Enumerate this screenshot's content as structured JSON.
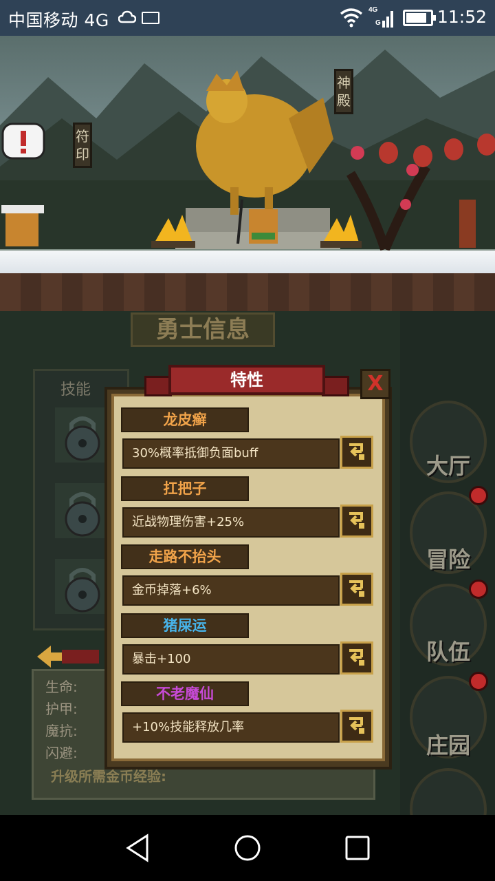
{
  "status_bar": {
    "carrier": "中国移动 4G",
    "time": "11:52",
    "network_type": "4G",
    "battery_level": 0.85
  },
  "scene": {
    "sign_left": "符印",
    "sign_right": "神殿"
  },
  "hero_panel": {
    "title": "勇士信息",
    "skills_label": "技能",
    "stats": {
      "hp_label": "生命:",
      "armor_label": "护甲:",
      "magic_resist_label": "魔抗:",
      "dodge_label": "闪避:",
      "exp_label": "升级所需金币经验:"
    }
  },
  "menu": {
    "hall": "大厅",
    "adventure": "冒险",
    "team": "队伍",
    "manor": "庄园"
  },
  "trait_dialog": {
    "title": "特性",
    "close_symbol": "X",
    "traits": [
      {
        "name": "龙皮癣",
        "name_color": "#f2a44a",
        "desc": "30%概率抵御负面buff"
      },
      {
        "name": "扛把子",
        "name_color": "#f2a44a",
        "desc": "近战物理伤害+25%"
      },
      {
        "name": "走路不抬头",
        "name_color": "#f2a44a",
        "desc": "金币掉落+6%"
      },
      {
        "name": "猪屎运",
        "name_color": "#47b4ea",
        "desc": "暴击+100"
      },
      {
        "name": "不老魔仙",
        "name_color": "#c74ad6",
        "desc": "+10%技能释放几率"
      }
    ]
  },
  "colors": {
    "accent_red": "#9a2a2a",
    "panel_bg": "#233026",
    "dialog_parchment": "#d6c79a",
    "status_bar": "#2f4256"
  }
}
